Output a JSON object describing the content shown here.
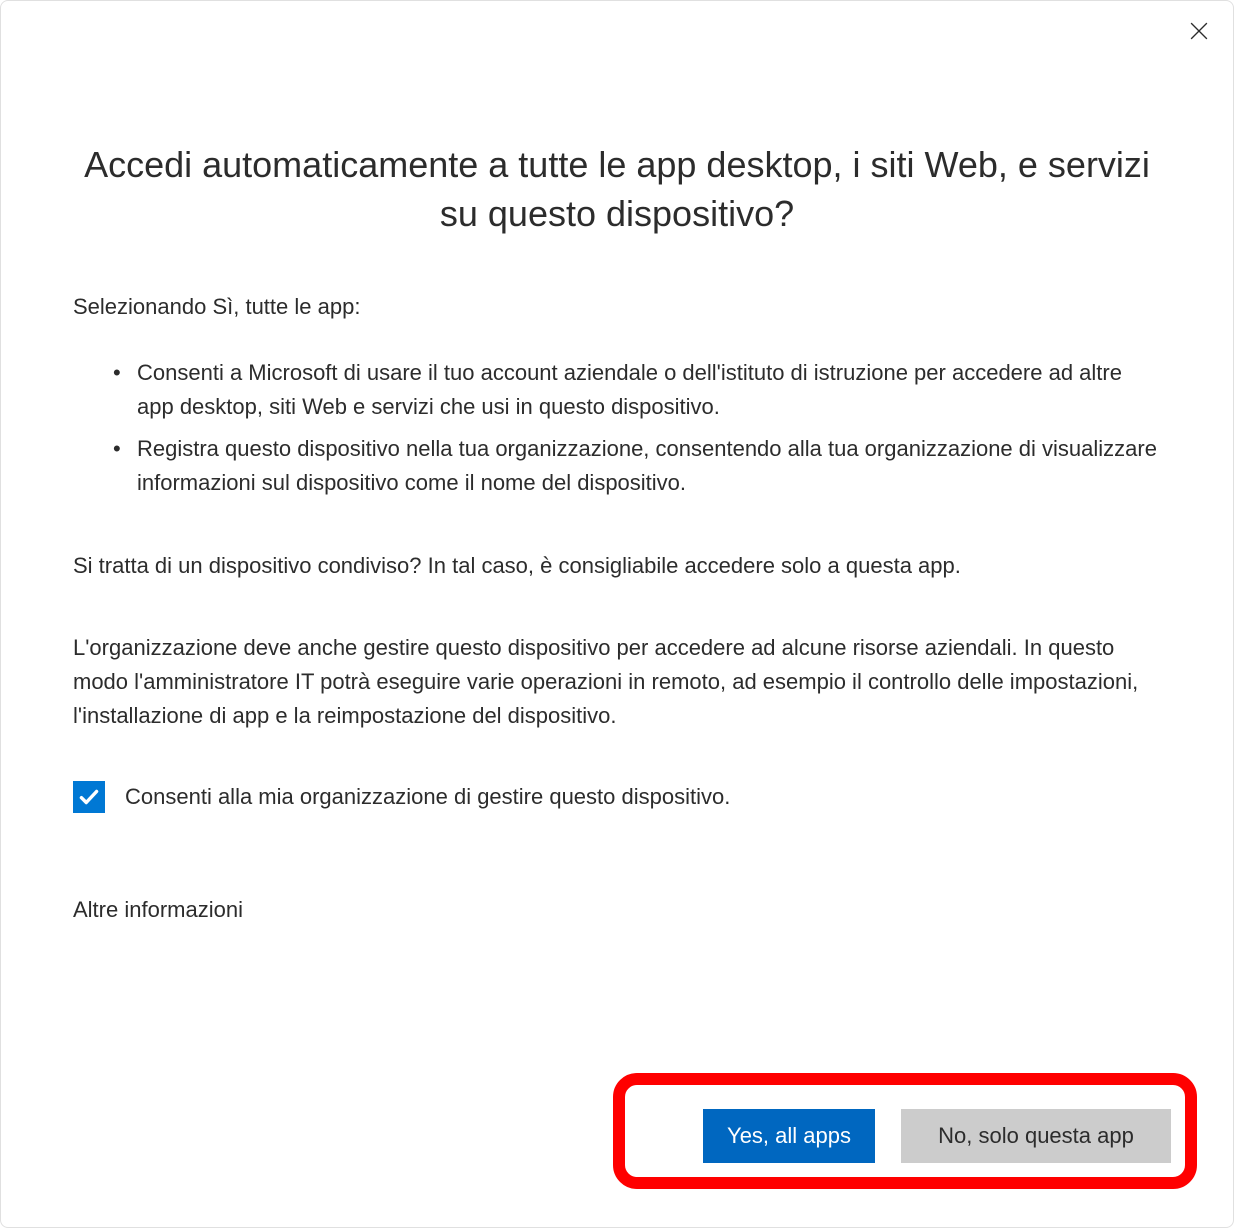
{
  "dialog": {
    "title": "Accedi automaticamente a tutte le app desktop, i siti Web, e servizi su questo dispositivo?",
    "intro": "Selezionando Sì, tutte le app:",
    "bullets": [
      "Consenti a Microsoft di usare il tuo account aziendale o dell'istituto di istruzione per accedere ad altre app desktop, siti Web e servizi che usi in questo dispositivo.",
      "Registra questo dispositivo nella tua organizzazione, consentendo alla tua organizzazione di visualizzare informazioni sul dispositivo come il nome del dispositivo."
    ],
    "shared_device_text": "Si tratta di un dispositivo condiviso? In tal caso, è consigliabile accedere solo a questa app.",
    "org_manage_text": "L'organizzazione deve anche gestire questo dispositivo per accedere ad alcune risorse aziendali. In questo modo l'amministratore IT potrà eseguire varie operazioni in remoto, ad esempio il controllo delle impostazioni, l'installazione di app e la reimpostazione del dispositivo.",
    "checkbox_label": "Consenti alla mia organizzazione di gestire questo dispositivo.",
    "checkbox_checked": true,
    "more_info_label": "Altre informazioni",
    "primary_button": "Yes, all apps",
    "secondary_button": "No, solo questa app"
  }
}
